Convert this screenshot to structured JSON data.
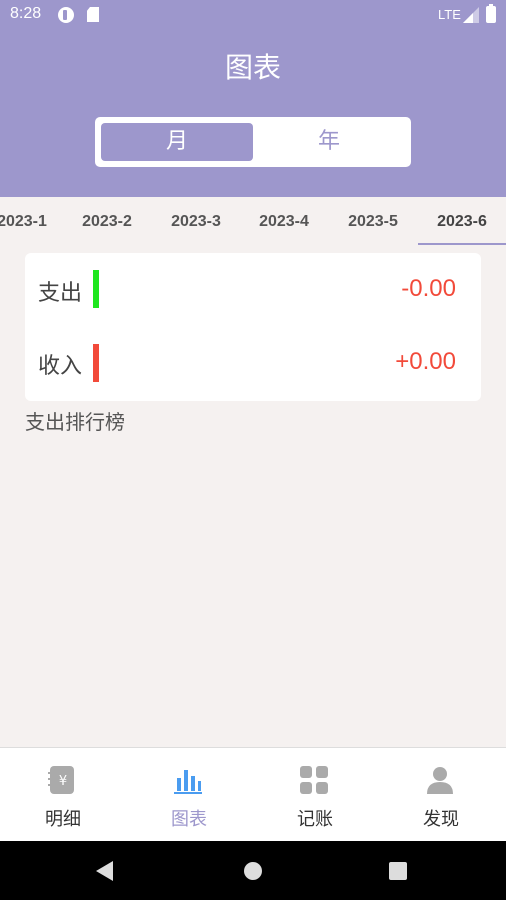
{
  "status": {
    "time": "8:28",
    "network": "LTE"
  },
  "header": {
    "title": "图表"
  },
  "segmented": {
    "month_label": "月",
    "year_label": "年",
    "selected": "month"
  },
  "months": [
    "2023-1",
    "2023-2",
    "2023-3",
    "2023-4",
    "2023-5",
    "2023-6"
  ],
  "selected_month": "2023-6",
  "summary": {
    "expense_label": "支出",
    "expense_value": "-0.00",
    "income_label": "收入",
    "income_value": "+0.00"
  },
  "ranking_title": "支出排行榜",
  "tabs": [
    {
      "label": "明细",
      "icon": "ledger-icon"
    },
    {
      "label": "图表",
      "icon": "bar-chart-icon"
    },
    {
      "label": "记账",
      "icon": "grid-icon"
    },
    {
      "label": "发现",
      "icon": "person-icon"
    }
  ],
  "colors": {
    "accent": "#9d97cc",
    "expense_bar": "#1ee61e",
    "income_bar": "#f24a3a",
    "value_red": "#f24a3a",
    "tab_active_icon": "#4a9cf0",
    "tab_inactive_icon": "#aaaaaa"
  }
}
